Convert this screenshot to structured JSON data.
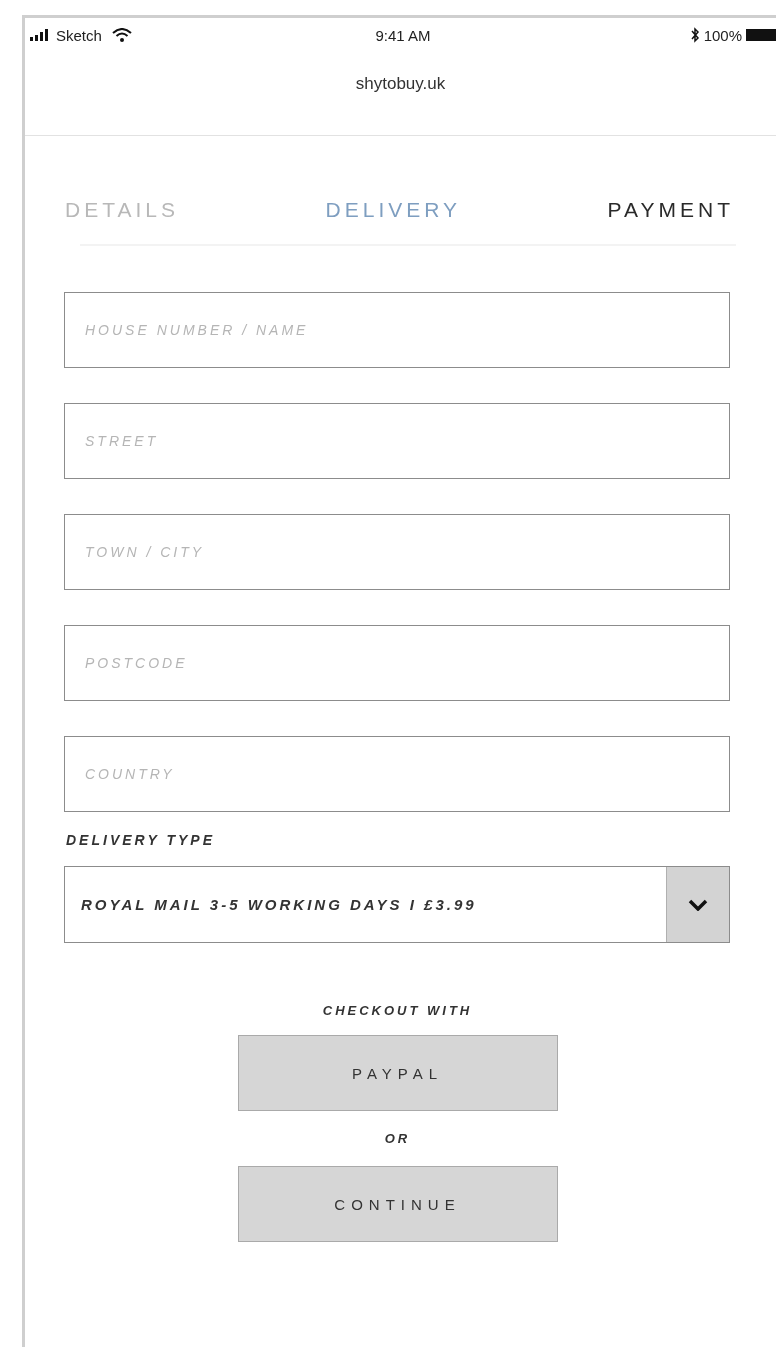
{
  "status_bar": {
    "carrier": "Sketch",
    "time": "9:41 AM",
    "battery": "100%"
  },
  "address_bar": {
    "url": "shytobuy.uk"
  },
  "steps": [
    {
      "label": "DETAILS",
      "selected": false,
      "visited": true
    },
    {
      "label": "DELIVERY",
      "selected": true,
      "visited": true
    },
    {
      "label": "PAYMENT",
      "selected": false,
      "visited": false
    }
  ],
  "fields": [
    {
      "placeholder": "HOUSE NUMBER / NAME"
    },
    {
      "placeholder": "STREET"
    },
    {
      "placeholder": "TOWN / CITY"
    },
    {
      "placeholder": "POSTCODE"
    },
    {
      "placeholder": "COUNTRY"
    }
  ],
  "delivery_type": {
    "label": "DELIVERY TYPE",
    "value": "ROYAL MAIL 3-5 WORKING DAYS I £3.99"
  },
  "checkout": {
    "heading": "CHECKOUT WITH",
    "paypal_button": "PAYPAL",
    "separator": "OR",
    "continue_button": "CONTINUE"
  }
}
